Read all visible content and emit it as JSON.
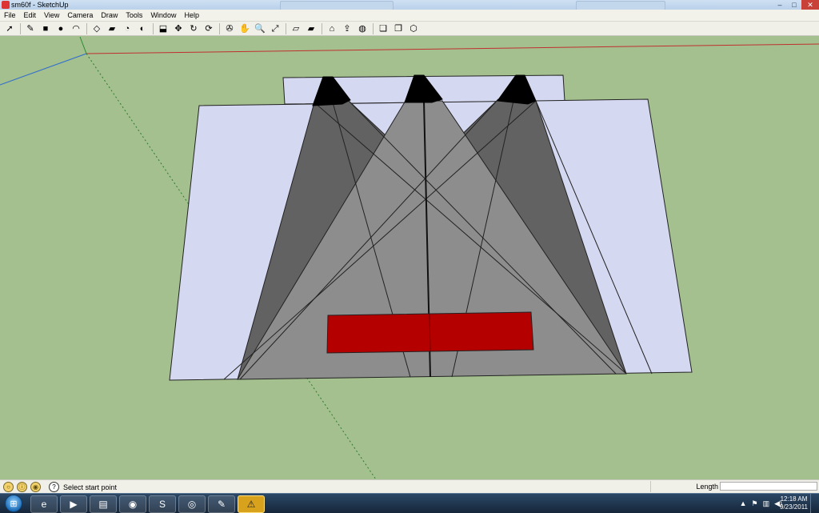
{
  "window": {
    "title": "sm60f - SketchUp",
    "controls": [
      "–",
      "□",
      "✕"
    ]
  },
  "menu": [
    "File",
    "Edit",
    "View",
    "Camera",
    "Draw",
    "Tools",
    "Window",
    "Help"
  ],
  "toolbar": {
    "groups": [
      [
        {
          "name": "select-icon",
          "glyph": "➚"
        }
      ],
      [
        {
          "name": "pencil-icon",
          "glyph": "✎"
        },
        {
          "name": "rectangle-icon",
          "glyph": "■"
        },
        {
          "name": "circle-icon",
          "glyph": "●"
        },
        {
          "name": "arc-icon",
          "glyph": "◠"
        }
      ],
      [
        {
          "name": "make-component-icon",
          "glyph": "◇"
        },
        {
          "name": "eraser-icon",
          "glyph": "▰"
        },
        {
          "name": "tape-measure-icon",
          "glyph": "◔"
        },
        {
          "name": "paint-bucket-icon",
          "glyph": "◐"
        }
      ],
      [
        {
          "name": "push-pull-icon",
          "glyph": "⬓"
        },
        {
          "name": "move-icon",
          "glyph": "✥"
        },
        {
          "name": "rotate-icon",
          "glyph": "↻"
        },
        {
          "name": "offset-icon",
          "glyph": "⟳"
        }
      ],
      [
        {
          "name": "orbit-icon",
          "glyph": "✇"
        },
        {
          "name": "pan-icon",
          "glyph": "✋"
        },
        {
          "name": "zoom-icon",
          "glyph": "🔍"
        },
        {
          "name": "zoom-extents-icon",
          "glyph": "⤢"
        }
      ],
      [
        {
          "name": "previous-view-icon",
          "glyph": "▱"
        },
        {
          "name": "next-view-icon",
          "glyph": "▰"
        }
      ],
      [
        {
          "name": "3d-warehouse-icon",
          "glyph": "⌂"
        },
        {
          "name": "share-model-icon",
          "glyph": "⇪"
        },
        {
          "name": "google-earth-icon",
          "glyph": "◍"
        }
      ],
      [
        {
          "name": "get-models-icon",
          "glyph": "❏"
        },
        {
          "name": "share-component-icon",
          "glyph": "❐"
        },
        {
          "name": "extension-icon",
          "glyph": "⬡"
        }
      ]
    ]
  },
  "statusbar": {
    "status_text": "Select start point",
    "measure_label": "Length",
    "measure_value": ""
  },
  "taskbar": {
    "apps": [
      {
        "name": "internet-explorer-icon",
        "glyph": "e",
        "active": false
      },
      {
        "name": "media-player-icon",
        "glyph": "▶",
        "active": false
      },
      {
        "name": "file-explorer-icon",
        "glyph": "▤",
        "active": false
      },
      {
        "name": "chrome-icon",
        "glyph": "◉",
        "active": false
      },
      {
        "name": "skype-icon",
        "glyph": "S",
        "active": false
      },
      {
        "name": "network-icon",
        "glyph": "◎",
        "active": false
      },
      {
        "name": "sketchup-icon",
        "glyph": "✎",
        "active": false
      },
      {
        "name": "warning-icon",
        "glyph": "⚠",
        "active": true
      }
    ],
    "clock_time": "12:18 AM",
    "clock_date": "9/23/2011"
  },
  "colors": {
    "ground": "#a3c08e",
    "floor": "#d4d8f1",
    "dark_cone": "#626262",
    "light_cone": "#8d8d8d",
    "red_block": "#b50000"
  }
}
